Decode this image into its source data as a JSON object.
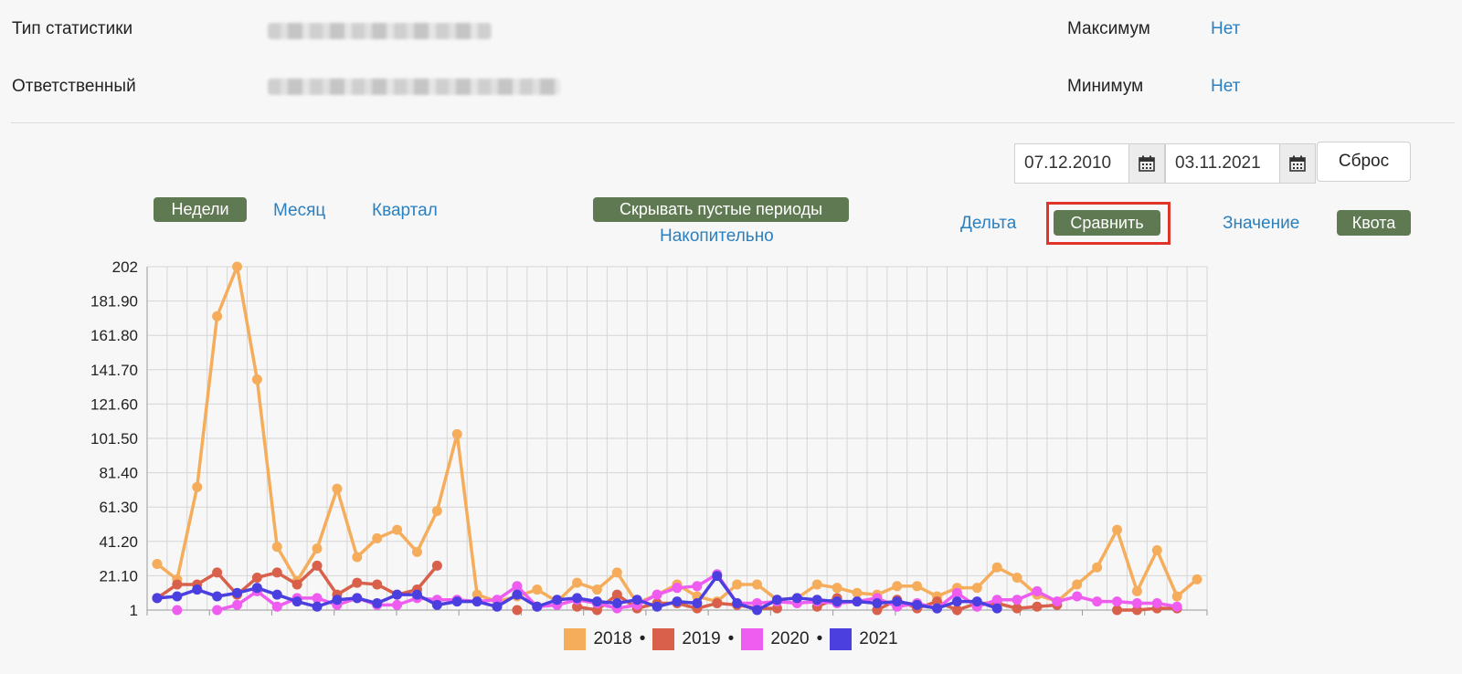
{
  "info": {
    "stat_type_label": "Тип статистики",
    "responsible_label": "Ответственный",
    "max_label": "Максимум",
    "max_value": "Нет",
    "min_label": "Минимум",
    "min_value": "Нет"
  },
  "filters": {
    "date_from": "07.12.2010",
    "date_to": "03.11.2021",
    "reset_label": "Сброс"
  },
  "periods": {
    "weeks": "Недели",
    "month": "Месяц",
    "quarter": "Квартал",
    "hide_empty": "Скрывать пустые периоды",
    "cumulative": "Накопительно"
  },
  "modes": {
    "delta": "Дельта",
    "compare": "Сравнить",
    "value": "Значение",
    "quota": "Квота"
  },
  "colors": {
    "active_button": "#5f7a52",
    "link": "#2a80c0",
    "highlight": "#e0332a"
  },
  "chart_data": {
    "type": "line",
    "y_ticks": [
      "202",
      "181.90",
      "161.80",
      "141.70",
      "121.60",
      "101.50",
      "81.40",
      "61.30",
      "41.20",
      "21.10",
      "1"
    ],
    "ylim": [
      1,
      202
    ],
    "grid": true,
    "legend_position": "bottom",
    "legend_separator": "•",
    "series": [
      {
        "name": "2018",
        "color": "#f5ad5c",
        "values": [
          28,
          19,
          73,
          173,
          202,
          136,
          38,
          18,
          37,
          72,
          32,
          43,
          48,
          35,
          59,
          104,
          10,
          6,
          9,
          13,
          6,
          17,
          13,
          23,
          5,
          10,
          16,
          9,
          6,
          16,
          16,
          7,
          8,
          16,
          14,
          11,
          10,
          15,
          15,
          9,
          14,
          14,
          26,
          20,
          10,
          6,
          16,
          26,
          48,
          12,
          36,
          9,
          19
        ]
      },
      {
        "name": "2019",
        "color": "#d9604a",
        "values": [
          8,
          16,
          16,
          23,
          10,
          20,
          23,
          16,
          27,
          10,
          17,
          16,
          10,
          13,
          27,
          null,
          null,
          null,
          1,
          null,
          null,
          3,
          1,
          10,
          2,
          5,
          5,
          2,
          5,
          4,
          2,
          2,
          null,
          3,
          8,
          null,
          1,
          7,
          2,
          6,
          1,
          5,
          5,
          2,
          3,
          4,
          null,
          null,
          1,
          1,
          2,
          2,
          null
        ]
      },
      {
        "name": "2020",
        "color": "#ee5cf0",
        "values": [
          null,
          1,
          null,
          1,
          4,
          12,
          3,
          8,
          8,
          4,
          8,
          4,
          4,
          8,
          7,
          7,
          6,
          7,
          15,
          3,
          4,
          7,
          5,
          2,
          4,
          10,
          14,
          15,
          22,
          5,
          5,
          6,
          5,
          6,
          5,
          6,
          8,
          3,
          5,
          2,
          11,
          3,
          7,
          7,
          12,
          6,
          9,
          6,
          6,
          5,
          5,
          3
        ]
      },
      {
        "name": "2021",
        "color": "#4b3fe0",
        "values": [
          8,
          9,
          13,
          9,
          11,
          14,
          10,
          6,
          3,
          7,
          8,
          5,
          10,
          10,
          4,
          6,
          6,
          3,
          10,
          3,
          7,
          8,
          6,
          5,
          7,
          3,
          6,
          5,
          21,
          5,
          1,
          7,
          8,
          7,
          6,
          6,
          5,
          6,
          4,
          2,
          6,
          6,
          2
        ]
      }
    ]
  }
}
